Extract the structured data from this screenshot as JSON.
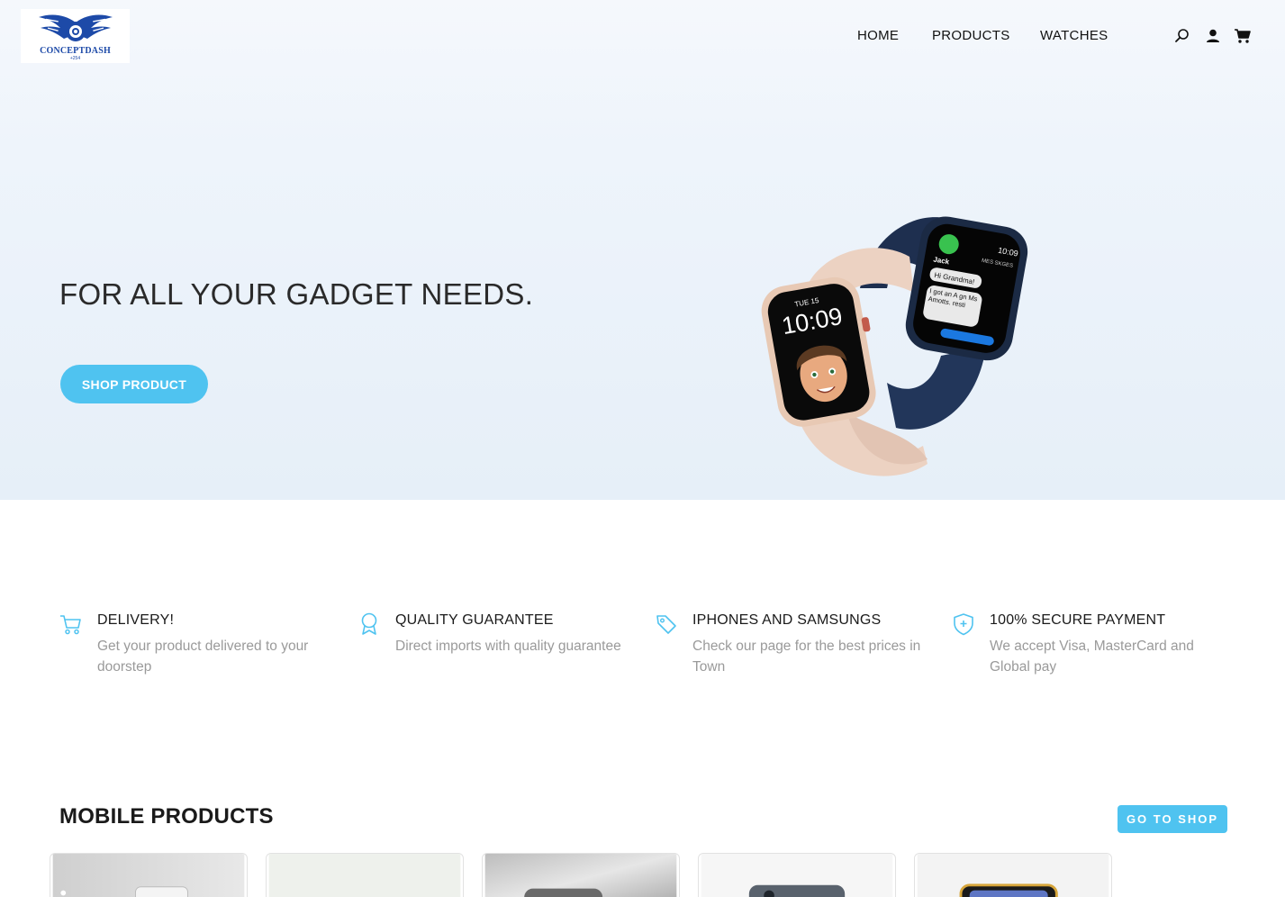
{
  "brand": {
    "name": "CONCEPTDASH",
    "sub": "+254"
  },
  "nav": {
    "home": "HOME",
    "products": "PRODUCTS",
    "watches": "WATCHES"
  },
  "header_icons": [
    "search-icon",
    "user-icon",
    "cart-icon"
  ],
  "hero": {
    "headline": "FOR ALL YOUR GADGET NEEDS.",
    "cta": "SHOP PRODUCT",
    "watch_screen_left": {
      "date": "TUE 15",
      "time": "10:09"
    },
    "watch_screen_right": {
      "time": "10:09",
      "header": "MES SKGES",
      "sender": "Jack",
      "bubble1": "Hi Grandma!",
      "bubble2": "I got an A gn Ms Amotts. resti"
    }
  },
  "features": [
    {
      "icon": "cart-icon",
      "title": "DELIVERY!",
      "desc": "Get your product delivered to your doorstep"
    },
    {
      "icon": "award-icon",
      "title": "QUALITY GUARANTEE",
      "desc": "Direct imports with quality guarantee"
    },
    {
      "icon": "tag-icon",
      "title": "IPHONES AND SAMSUNGS",
      "desc": "Check our page for the best prices in Town"
    },
    {
      "icon": "shield-icon",
      "title": "100% SECURE PAYMENT",
      "desc": "We accept Visa, MasterCard and Global pay"
    }
  ],
  "products_section": {
    "title": "MOBILE PRODUCTS",
    "go_to_shop": "GO TO SHOP"
  },
  "colors": {
    "accent": "#4fc3f0",
    "brand_blue": "#1d4aa8",
    "muted_text": "#9a9a9a"
  }
}
